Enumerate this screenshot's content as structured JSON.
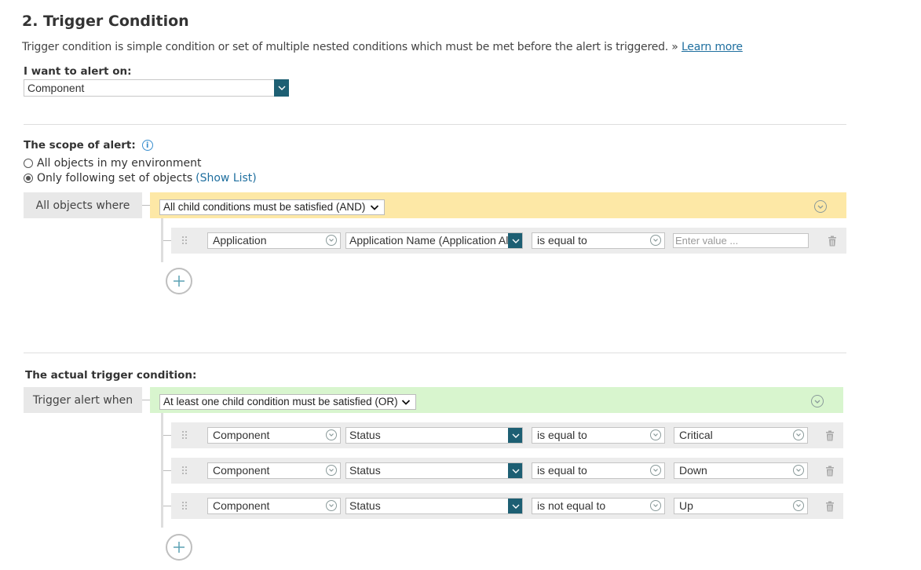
{
  "section": {
    "title": "2. Trigger Condition",
    "description": "Trigger condition is simple condition or set of multiple nested conditions which must be met before the alert is triggered. »",
    "learn_more": "Learn more"
  },
  "alert_on": {
    "label": "I want to alert on:",
    "value": "Component"
  },
  "scope": {
    "label": "The scope of alert:",
    "options": [
      {
        "label": "All objects in my environment",
        "checked": false
      },
      {
        "label": "Only following set of objects",
        "checked": true
      }
    ],
    "show_list": "(Show List)",
    "side_label": "All objects where",
    "group_condition": "All child conditions must be satisfied (AND)",
    "group_color": "#fde8a6",
    "rows": [
      {
        "object": "Application",
        "field": "Application Name (Application Ale",
        "operator": "is equal to",
        "value_placeholder": "Enter value ..."
      }
    ]
  },
  "trigger": {
    "label": "The actual trigger condition:",
    "side_label": "Trigger alert when",
    "group_condition": "At least one child condition must be satisfied (OR)",
    "group_color": "#d8f5ce",
    "rows": [
      {
        "object": "Component",
        "field": "Status",
        "operator": "is equal to",
        "value": "Critical"
      },
      {
        "object": "Component",
        "field": "Status",
        "operator": "is equal to",
        "value": "Down"
      },
      {
        "object": "Component",
        "field": "Status",
        "operator": "is not equal to",
        "value": "Up"
      }
    ]
  },
  "icons": {
    "dropdown": "chevron-down-icon",
    "grip": "drag-handle-icon",
    "trash": "trash-icon",
    "add": "plus-icon",
    "info": "info-icon"
  }
}
